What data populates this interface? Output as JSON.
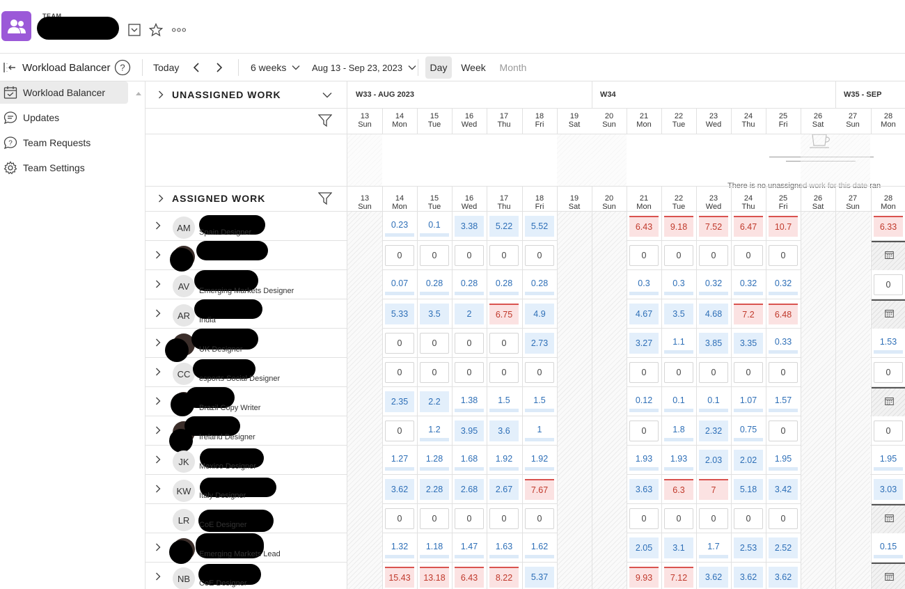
{
  "header": {
    "team_label": "TEAM"
  },
  "toolbar": {
    "title": "Workload Balancer",
    "today": "Today",
    "range_length": "6 weeks",
    "date_range": "Aug 13 - Sep 23, 2023",
    "views": [
      "Day",
      "Week",
      "Month"
    ]
  },
  "sidebar": {
    "items": [
      {
        "label": "Workload Balancer"
      },
      {
        "label": "Updates"
      },
      {
        "label": "Team Requests"
      },
      {
        "label": "Team Settings"
      }
    ]
  },
  "grid": {
    "unassigned_title": "UNASSIGNED WORK",
    "assigned_title": "ASSIGNED WORK",
    "empty_message": "There is no unassigned work for this date ran",
    "weeks": [
      "W33 - AUG 2023",
      "W34",
      "W35 - SEP"
    ],
    "days": [
      {
        "num": "13",
        "dow": "Sun"
      },
      {
        "num": "14",
        "dow": "Mon"
      },
      {
        "num": "15",
        "dow": "Tue"
      },
      {
        "num": "16",
        "dow": "Wed"
      },
      {
        "num": "17",
        "dow": "Thu"
      },
      {
        "num": "18",
        "dow": "Fri"
      },
      {
        "num": "19",
        "dow": "Sat"
      },
      {
        "num": "20",
        "dow": "Sun"
      },
      {
        "num": "21",
        "dow": "Mon"
      },
      {
        "num": "22",
        "dow": "Tue"
      },
      {
        "num": "23",
        "dow": "Wed"
      },
      {
        "num": "24",
        "dow": "Thu"
      },
      {
        "num": "25",
        "dow": "Fri"
      },
      {
        "num": "26",
        "dow": "Sat"
      },
      {
        "num": "27",
        "dow": "Sun"
      },
      {
        "num": "28",
        "dow": "Mon"
      }
    ]
  },
  "people": [
    {
      "initials": "AM",
      "role": "Spain Designer",
      "w1": [
        "0.23",
        "0.1",
        "3.38",
        "5.22",
        "5.52"
      ],
      "w2": [
        "6.43",
        "9.18",
        "7.52",
        "6.47",
        "10.7"
      ],
      "last": "6.33"
    },
    {
      "initials": "",
      "role": "",
      "photo": true,
      "w1": [
        "0",
        "0",
        "0",
        "0",
        "0"
      ],
      "w2": [
        "0",
        "0",
        "0",
        "0",
        "0"
      ],
      "last": ""
    },
    {
      "initials": "AV",
      "role": "Emerging Markets Designer",
      "w1": [
        "0.07",
        "0.28",
        "0.28",
        "0.28",
        "0.28"
      ],
      "w2": [
        "0.3",
        "0.3",
        "0.32",
        "0.32",
        "0.32"
      ],
      "last": "0"
    },
    {
      "initials": "AR",
      "role": "India",
      "w1": [
        "5.33",
        "3.5",
        "2",
        "6.75",
        "4.9"
      ],
      "w2": [
        "4.67",
        "3.5",
        "4.68",
        "7.2",
        "6.48"
      ],
      "last": ""
    },
    {
      "initials": "",
      "role": "UK Designer",
      "photo": true,
      "w1": [
        "0",
        "0",
        "0",
        "0",
        "2.73"
      ],
      "w2": [
        "3.27",
        "1.1",
        "3.85",
        "3.35",
        "0.33"
      ],
      "last": "1.53"
    },
    {
      "initials": "CC",
      "role": "esports Social Designer",
      "w1": [
        "0",
        "0",
        "0",
        "0",
        "0"
      ],
      "w2": [
        "0",
        "0",
        "0",
        "0",
        "0"
      ],
      "last": "0"
    },
    {
      "initials": "",
      "role": "Brazil Copy Writer",
      "photo": true,
      "w1": [
        "2.35",
        "2.2",
        "1.38",
        "1.5",
        "1.5"
      ],
      "w2": [
        "0.12",
        "0.1",
        "0.1",
        "1.07",
        "1.57"
      ],
      "last": ""
    },
    {
      "initials": "",
      "role": "Ireland Designer",
      "photo": true,
      "w1": [
        "0",
        "1.2",
        "3.95",
        "3.6",
        "1"
      ],
      "w2": [
        "0",
        "1.8",
        "2.32",
        "0.75",
        "0"
      ],
      "last": "0"
    },
    {
      "initials": "JK",
      "role": "Mexico Designer",
      "w1": [
        "1.27",
        "1.28",
        "1.68",
        "1.92",
        "1.92"
      ],
      "w2": [
        "1.93",
        "1.93",
        "2.03",
        "2.02",
        "1.95"
      ],
      "last": "1.95"
    },
    {
      "initials": "KW",
      "role": "Italy Designer",
      "w1": [
        "3.62",
        "2.28",
        "2.68",
        "2.67",
        "7.67"
      ],
      "w2": [
        "3.63",
        "6.3",
        "7",
        "5.18",
        "3.42"
      ],
      "last": "3.03"
    },
    {
      "initials": "LR",
      "role": "CoE Designer",
      "nochev": true,
      "w1": [
        "0",
        "0",
        "0",
        "0",
        "0"
      ],
      "w2": [
        "0",
        "0",
        "0",
        "0",
        "0"
      ],
      "last": ""
    },
    {
      "initials": "",
      "role": "Emerging Markets Lead",
      "photo": true,
      "w1": [
        "1.32",
        "1.18",
        "1.47",
        "1.63",
        "1.62"
      ],
      "w2": [
        "2.05",
        "3.1",
        "1.7",
        "2.53",
        "2.52"
      ],
      "last": "0.15"
    },
    {
      "initials": "NB",
      "role": "CoE Designer",
      "w1": [
        "15.43",
        "13.18",
        "6.43",
        "8.22",
        "5.37"
      ],
      "w2": [
        "9.93",
        "7.12",
        "3.62",
        "3.62",
        "3.62"
      ],
      "last": ""
    }
  ]
}
